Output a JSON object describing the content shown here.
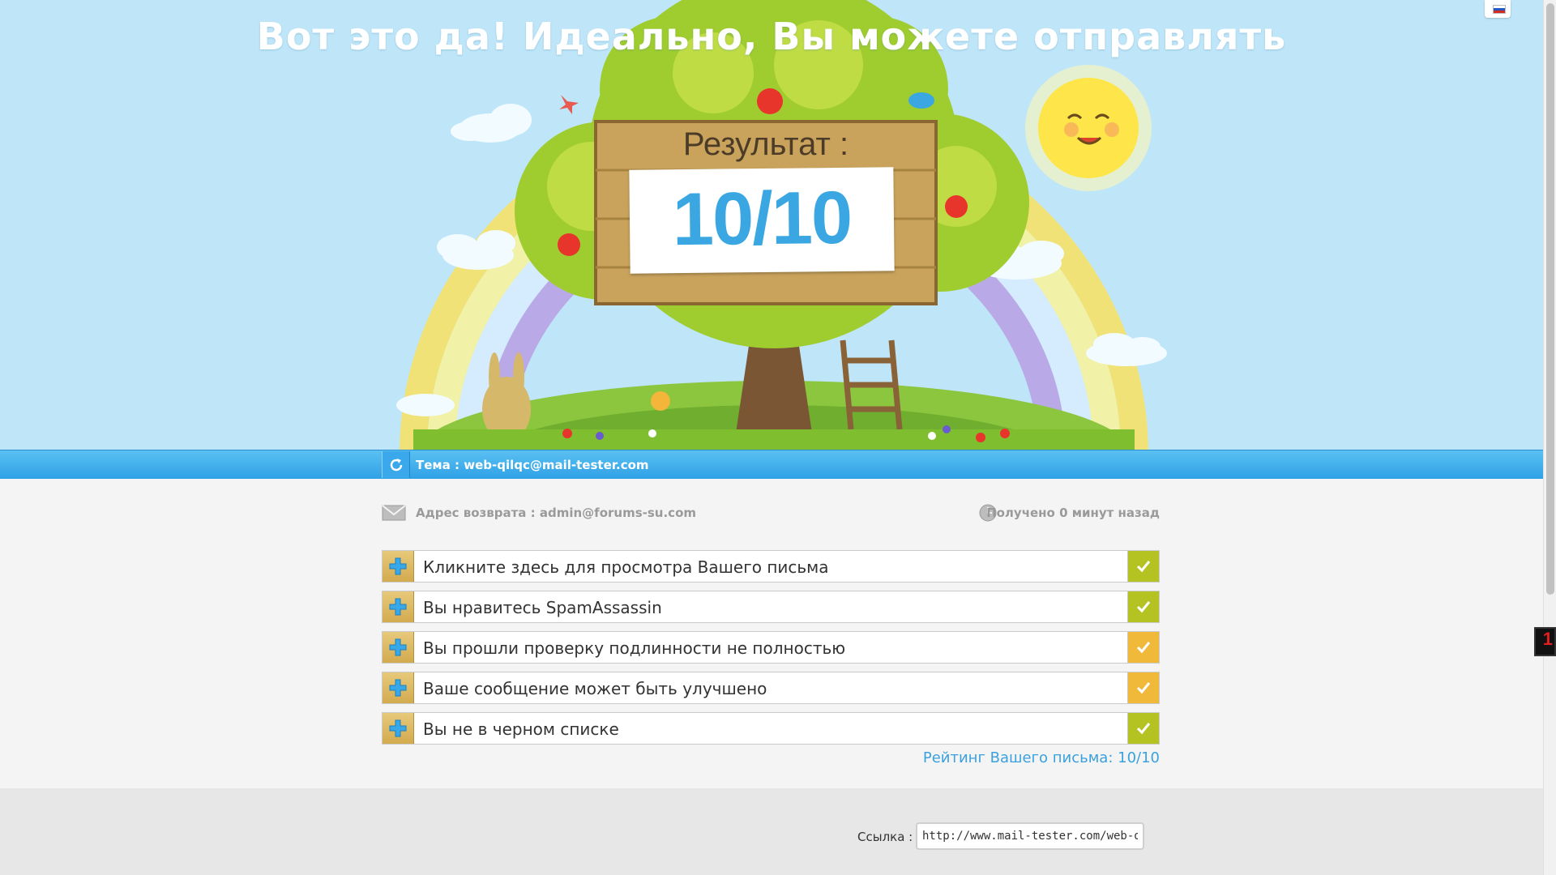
{
  "hero": {
    "headline": "Вот это да! Идеально, Вы можете отправлять",
    "result_label": "Результат :",
    "score": "10/10",
    "language_flag": "ru-flag-icon"
  },
  "subject_bar": {
    "refresh_icon": "refresh-icon",
    "subject": "Тема : web-qilqc@mail-tester.com"
  },
  "meta": {
    "return_address": "Адрес возврата : admin@forums-su.com",
    "received": "Получено 0 минут назад"
  },
  "checks": [
    {
      "label": "Кликните здесь для просмотра Вашего письма",
      "status": "ok",
      "color": "#b5c322"
    },
    {
      "label": "Вы нравитесь SpamAssassin",
      "status": "ok",
      "color": "#b5c322"
    },
    {
      "label": "Вы прошли проверку подлинности не полностью",
      "status": "warning",
      "color": "#f0b93a"
    },
    {
      "label": "Ваше сообщение может быть улучшено",
      "status": "warning",
      "color": "#f0b93a"
    },
    {
      "label": "Вы не в черном списке",
      "status": "ok",
      "color": "#b5c322"
    }
  ],
  "rating": "Рейтинг Вашего письма: 10/10",
  "footer": {
    "link_label": "Ссылка :",
    "link_value": "http://www.mail-tester.com/web-qilqc"
  },
  "side_widget": "1",
  "colors": {
    "accent_blue": "#3aa7e2",
    "ok_green": "#b5c322",
    "warning_orange": "#f0b93a"
  }
}
